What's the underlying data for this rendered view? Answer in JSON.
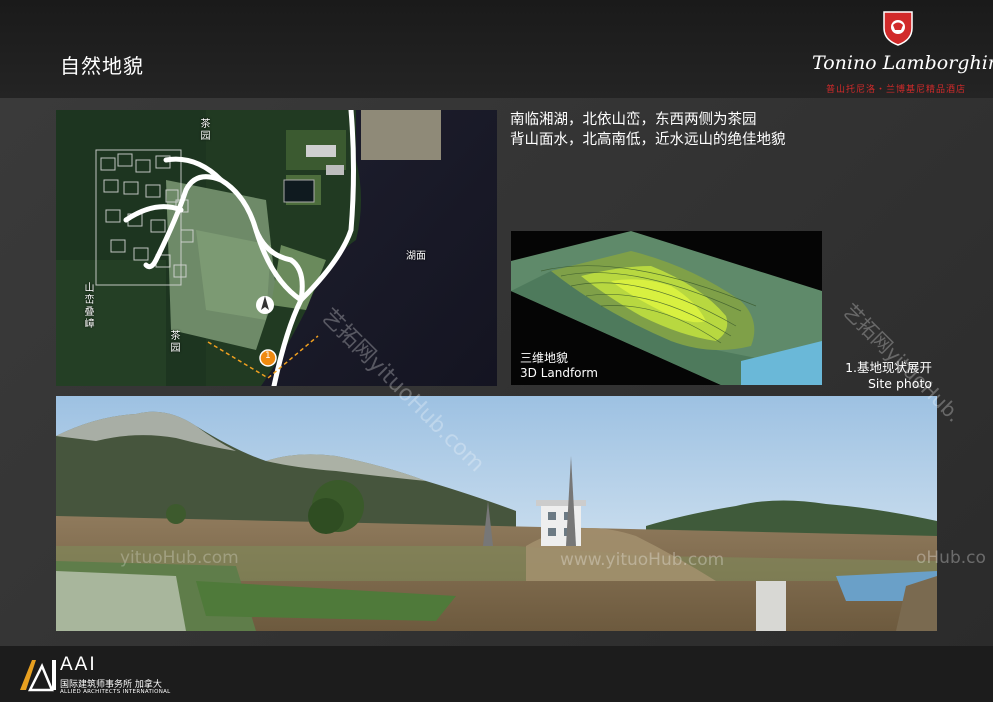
{
  "page": {
    "title": "自然地貌"
  },
  "brand": {
    "name": "Tonino Lamborghini",
    "subtitle": "普山托尼洛・兰博基尼精品酒店",
    "shield_icon": "bull-shield-icon",
    "shield_color": "#d12a2a"
  },
  "map": {
    "labels": {
      "tea_garden_top": "茶园",
      "tea_garden_bottom": "茶园",
      "mountain": "山峦叠嶂",
      "lake": "湖面"
    },
    "marker": "1"
  },
  "description": {
    "line1": "南临湘湖，北依山峦，东西两侧为茶园",
    "line2": "背山面水，北高南低，近水远山的绝佳地貌"
  },
  "landform": {
    "caption_cn": "三维地貌",
    "caption_en": "3D Landform"
  },
  "site_photo": {
    "caption_cn": "1.基地现状展开",
    "caption_en": "Site photo"
  },
  "watermarks": [
    "艺拓网yituoHub.com",
    "艺拓网yituoHub.",
    "www.yituoHub.com",
    "yituoHub.com",
    "oHub.co"
  ],
  "footer": {
    "logo_title": "AAI",
    "logo_cn": "国际建筑师事务所 加拿大",
    "logo_en": "ALLIED ARCHITECTS INTERNATIONAL",
    "accent": "#e8a020"
  }
}
